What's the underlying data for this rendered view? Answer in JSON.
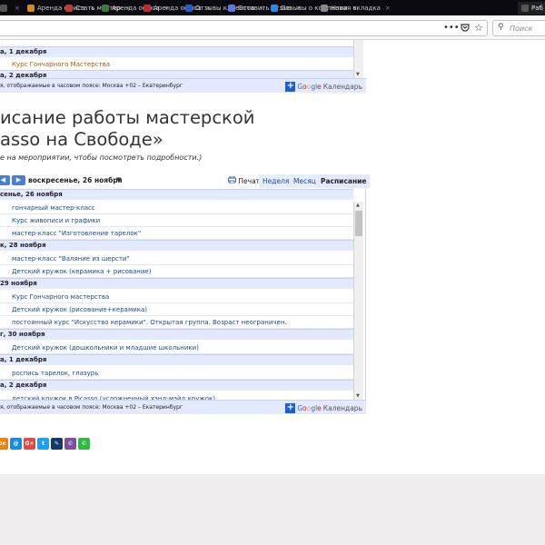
{
  "browser": {
    "tabs": [
      {
        "label": "",
        "color": "#555555"
      },
      {
        "label": "Арендa офиса",
        "color": "#d08a2a"
      },
      {
        "label": "Стать мастер",
        "color": "#c03a2a"
      },
      {
        "label": "Аренда офиса",
        "color": "#3a7a3a"
      },
      {
        "label": "Аренда офиса",
        "color": "#c02a2a"
      },
      {
        "label": "Отзывы клиентов",
        "color": "#2a5ac0"
      },
      {
        "label": "Оставить отзыв",
        "color": "#5a7ae0"
      },
      {
        "label": "Отзывы о компании",
        "color": "#2a8ae0"
      },
      {
        "label": "Новая вкладка",
        "color": "#888888"
      },
      {
        "label": "Раб",
        "color": "#555555"
      }
    ],
    "toolbar": {
      "more_icon": "•••",
      "pocket_icon": "pocket-icon",
      "bookmark_icon": "☆",
      "search_placeholder": "Поиск",
      "search_icon": "⚲"
    }
  },
  "top_calendar": {
    "days": [
      {
        "header": "а, 1 декабря",
        "events": []
      },
      {
        "header": "а, 2 декабря",
        "events": []
      }
    ],
    "event_between": "Курс Гончарного Мастерства",
    "footer_tz": "я, отображаемые в часовом поясе: Москва +02 – Екатеринбург",
    "gcal_label_google": "Google",
    "gcal_label_calendar": "Календарь"
  },
  "page": {
    "title_line1": "исание работы мастерской",
    "title_line2": "asso на Свободе»",
    "subtitle": "е на мероприятии, чтобы посмотреть подробности.)"
  },
  "calendar": {
    "prev_icon": "◀",
    "next_icon": "▶",
    "date_range": "воскресенье, 26 ноября",
    "dropdown_icon": "▼",
    "print_label": "Печать",
    "print_icon": "🖶",
    "tabs": {
      "week": "Неделя",
      "month": "Месяц",
      "agenda": "Расписание"
    },
    "days": [
      {
        "header": "сенье, 26 ноября",
        "events": [
          "гончарный мастер-класс",
          "Курс живописи и графики",
          "мастер-класс \"Изготовление тарелок\""
        ]
      },
      {
        "header": "к, 28 ноября",
        "events": [
          "мастер-класс \"Валяние из шерсти\"",
          "Детский кружок (керамика + рисование)"
        ]
      },
      {
        "header": "29 ноября",
        "events": [
          "Курс Гончарного мастерства",
          "Детский кружок (рисование+керамика)",
          "постоянный курс \"Искусство керамики\". Открытая группа. Возраст неограничен."
        ]
      },
      {
        "header": "г, 30 ноября",
        "events": [
          "Детский кружок (дошкольники и младшие школьники)"
        ]
      },
      {
        "header": "а, 1 декабря",
        "events": [
          "роспись тарелок, глазурь"
        ]
      },
      {
        "header": "а, 2 декабря",
        "events": [
          "детский кружок в Picasso (усложненный хэнд-мэйд кружок)"
        ]
      }
    ],
    "footer_tz": "я, отображаемые в часовом поясе: Москва +02 – Екатеринбург",
    "gcal_label_google": "Google",
    "gcal_label_calendar": "Календарь",
    "scroll_up": "▲",
    "scroll_down": "▼"
  },
  "share": [
    {
      "name": "odnoklassniki-icon",
      "glyph": "ок",
      "color": "#ee8208"
    },
    {
      "name": "mymail-icon",
      "glyph": "@",
      "color": "#168de2"
    },
    {
      "name": "google-plus-icon",
      "glyph": "G+",
      "color": "#dc4e41"
    },
    {
      "name": "twitter-icon",
      "glyph": "t",
      "color": "#1da1f2"
    },
    {
      "name": "livejournal-icon",
      "glyph": "✎",
      "color": "#15396b"
    },
    {
      "name": "viber-icon",
      "glyph": "✆",
      "color": "#7b519d"
    },
    {
      "name": "whatsapp-icon",
      "glyph": "✆",
      "color": "#30ba45"
    }
  ],
  "colors": {
    "accent": "#4a7fd6",
    "header_bg": "#e3e9ff",
    "link": "#1a4aa0"
  }
}
